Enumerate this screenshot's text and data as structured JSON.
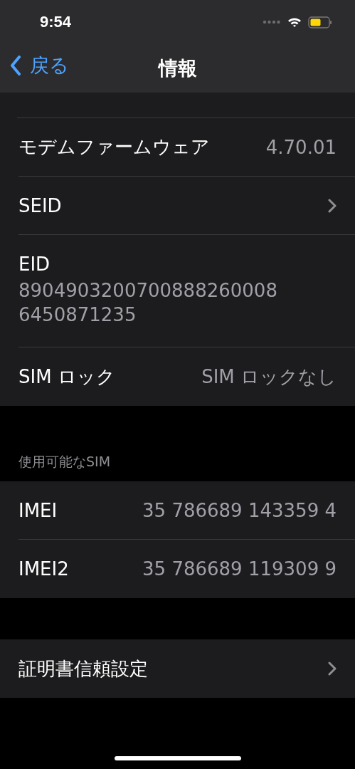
{
  "status_bar": {
    "time": "9:54"
  },
  "nav": {
    "back": "戻る",
    "title": "情報"
  },
  "sections": [
    {
      "rows": [
        {
          "kind": "value",
          "label": "モデムファームウェア",
          "value": "4.70.01"
        },
        {
          "kind": "link",
          "label": "SEID"
        },
        {
          "kind": "stacked",
          "label": "EID",
          "value": "89049032007008882600086450871235"
        },
        {
          "kind": "value",
          "label": "SIM ロック",
          "value": "SIM ロックなし"
        }
      ]
    },
    {
      "header": "使用可能なSIM",
      "rows": [
        {
          "kind": "value",
          "label": "IMEI",
          "value": "35 786689 143359 4"
        },
        {
          "kind": "value",
          "label": "IMEI2",
          "value": "35 786689 119309 9"
        }
      ]
    },
    {
      "rows": [
        {
          "kind": "link",
          "label": "証明書信頼設定"
        }
      ]
    }
  ]
}
